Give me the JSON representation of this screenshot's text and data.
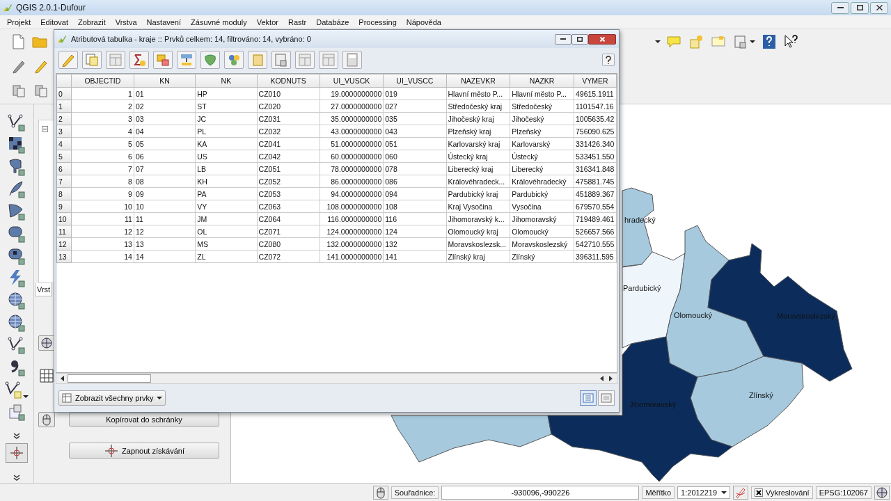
{
  "window": {
    "title": "QGIS 2.0.1-Dufour"
  },
  "menu": [
    "Projekt",
    "Editovat",
    "Zobrazit",
    "Vrstva",
    "Nastavení",
    "Zásuvné moduly",
    "Vektor",
    "Rastr",
    "Databáze",
    "Processing",
    "Nápověda"
  ],
  "left_panel": {
    "tab": "Vrst",
    "copy_button": "Kopírovat do schránky",
    "capture_button": "Zapnout získávání"
  },
  "map": {
    "labels": [
      "hradecký",
      "Pardubický",
      "Olomoucký",
      "Moravskoslezský",
      "Zlínský",
      "Jihomoravský"
    ]
  },
  "attribute_table": {
    "title": "Atributová tabulka - kraje :: Prvků celkem: 14, filtrováno: 14, vybráno: 0",
    "columns": [
      "OBJECTID",
      "KN",
      "NK",
      "KODNUTS",
      "UI_VUSCK",
      "UI_VUSCC",
      "NAZEVKR",
      "NAZKR",
      "VYMER"
    ],
    "rows": [
      {
        "header": "0",
        "cells": [
          "1",
          "01",
          "HP",
          "CZ010",
          "19.0000000000",
          "019",
          "Hlavní město P...",
          "Hlavní město P...",
          "49615.1911"
        ]
      },
      {
        "header": "1",
        "cells": [
          "2",
          "02",
          "ST",
          "CZ020",
          "27.0000000000",
          "027",
          "Středočeský kraj",
          "Středočeský",
          "1101547.16"
        ]
      },
      {
        "header": "2",
        "cells": [
          "3",
          "03",
          "JC",
          "CZ031",
          "35.0000000000",
          "035",
          "Jihočeský kraj",
          "Jihočeský",
          "1005635.42"
        ]
      },
      {
        "header": "3",
        "cells": [
          "4",
          "04",
          "PL",
          "CZ032",
          "43.0000000000",
          "043",
          "Plzeňský kraj",
          "Plzeňský",
          "756090.625"
        ]
      },
      {
        "header": "4",
        "cells": [
          "5",
          "05",
          "KA",
          "CZ041",
          "51.0000000000",
          "051",
          "Karlovarský kraj",
          "Karlovarský",
          "331426.340"
        ]
      },
      {
        "header": "5",
        "cells": [
          "6",
          "06",
          "US",
          "CZ042",
          "60.0000000000",
          "060",
          "Ústecký kraj",
          "Ústecký",
          "533451.550"
        ]
      },
      {
        "header": "6",
        "cells": [
          "7",
          "07",
          "LB",
          "CZ051",
          "78.0000000000",
          "078",
          "Liberecký kraj",
          "Liberecký",
          "316341.848"
        ]
      },
      {
        "header": "7",
        "cells": [
          "8",
          "08",
          "KH",
          "CZ052",
          "86.0000000000",
          "086",
          "Královéhradeck...",
          "Královéhradecký",
          "475881.745"
        ]
      },
      {
        "header": "8",
        "cells": [
          "9",
          "09",
          "PA",
          "CZ053",
          "94.0000000000",
          "094",
          "Pardubický kraj",
          "Pardubický",
          "451889.367"
        ]
      },
      {
        "header": "9",
        "cells": [
          "10",
          "10",
          "VY",
          "CZ063",
          "108.0000000000",
          "108",
          "Kraj Vysočina",
          "Vysočina",
          "679570.554"
        ]
      },
      {
        "header": "10",
        "cells": [
          "11",
          "11",
          "JM",
          "CZ064",
          "116.0000000000",
          "116",
          "Jihomoravský k...",
          "Jihomoravský",
          "719489.461"
        ]
      },
      {
        "header": "11",
        "cells": [
          "12",
          "12",
          "OL",
          "CZ071",
          "124.0000000000",
          "124",
          "Olomoucký kraj",
          "Olomoucký",
          "526657.566"
        ]
      },
      {
        "header": "12",
        "cells": [
          "13",
          "13",
          "MS",
          "CZ080",
          "132.0000000000",
          "132",
          "Moravskoslezsk...",
          "Moravskoslezský",
          "542710.555"
        ]
      },
      {
        "header": "13",
        "cells": [
          "14",
          "14",
          "ZL",
          "CZ072",
          "141.0000000000",
          "141",
          "Zlínský kraj",
          "Zlínský",
          "396311.595"
        ]
      }
    ],
    "filter_button": "Zobrazit všechny prvky"
  },
  "status_bar": {
    "coordinates_label": "Souřadnice:",
    "coordinates": "-930096,-990226",
    "scale_label": "Měřítko",
    "scale": "1:2012219",
    "render": {
      "label": "Vykreslování",
      "checked": true
    },
    "crs": "EPSG:102067"
  }
}
